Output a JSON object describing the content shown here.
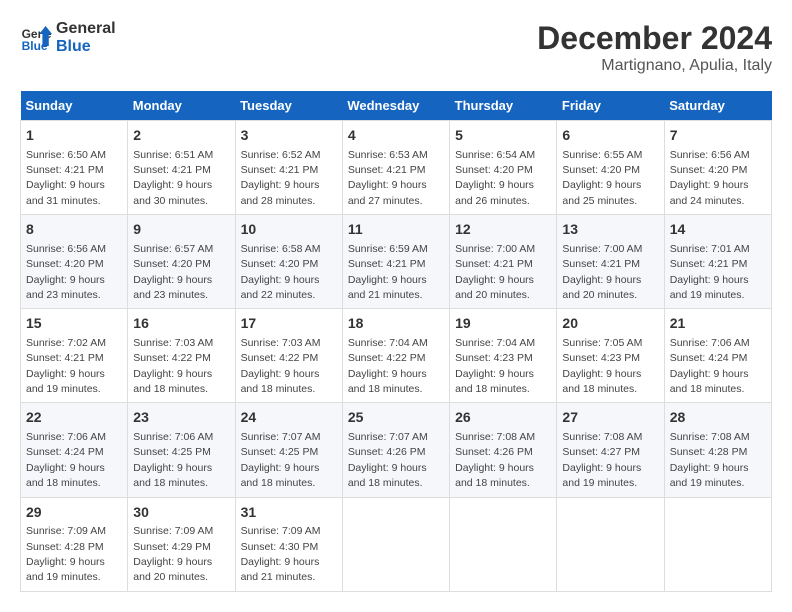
{
  "header": {
    "logo_line1": "General",
    "logo_line2": "Blue",
    "month_year": "December 2024",
    "location": "Martignano, Apulia, Italy"
  },
  "weekdays": [
    "Sunday",
    "Monday",
    "Tuesday",
    "Wednesday",
    "Thursday",
    "Friday",
    "Saturday"
  ],
  "weeks": [
    [
      {
        "day": "1",
        "sunrise": "Sunrise: 6:50 AM",
        "sunset": "Sunset: 4:21 PM",
        "daylight": "Daylight: 9 hours and 31 minutes."
      },
      {
        "day": "2",
        "sunrise": "Sunrise: 6:51 AM",
        "sunset": "Sunset: 4:21 PM",
        "daylight": "Daylight: 9 hours and 30 minutes."
      },
      {
        "day": "3",
        "sunrise": "Sunrise: 6:52 AM",
        "sunset": "Sunset: 4:21 PM",
        "daylight": "Daylight: 9 hours and 28 minutes."
      },
      {
        "day": "4",
        "sunrise": "Sunrise: 6:53 AM",
        "sunset": "Sunset: 4:21 PM",
        "daylight": "Daylight: 9 hours and 27 minutes."
      },
      {
        "day": "5",
        "sunrise": "Sunrise: 6:54 AM",
        "sunset": "Sunset: 4:20 PM",
        "daylight": "Daylight: 9 hours and 26 minutes."
      },
      {
        "day": "6",
        "sunrise": "Sunrise: 6:55 AM",
        "sunset": "Sunset: 4:20 PM",
        "daylight": "Daylight: 9 hours and 25 minutes."
      },
      {
        "day": "7",
        "sunrise": "Sunrise: 6:56 AM",
        "sunset": "Sunset: 4:20 PM",
        "daylight": "Daylight: 9 hours and 24 minutes."
      }
    ],
    [
      {
        "day": "8",
        "sunrise": "Sunrise: 6:56 AM",
        "sunset": "Sunset: 4:20 PM",
        "daylight": "Daylight: 9 hours and 23 minutes."
      },
      {
        "day": "9",
        "sunrise": "Sunrise: 6:57 AM",
        "sunset": "Sunset: 4:20 PM",
        "daylight": "Daylight: 9 hours and 23 minutes."
      },
      {
        "day": "10",
        "sunrise": "Sunrise: 6:58 AM",
        "sunset": "Sunset: 4:20 PM",
        "daylight": "Daylight: 9 hours and 22 minutes."
      },
      {
        "day": "11",
        "sunrise": "Sunrise: 6:59 AM",
        "sunset": "Sunset: 4:21 PM",
        "daylight": "Daylight: 9 hours and 21 minutes."
      },
      {
        "day": "12",
        "sunrise": "Sunrise: 7:00 AM",
        "sunset": "Sunset: 4:21 PM",
        "daylight": "Daylight: 9 hours and 20 minutes."
      },
      {
        "day": "13",
        "sunrise": "Sunrise: 7:00 AM",
        "sunset": "Sunset: 4:21 PM",
        "daylight": "Daylight: 9 hours and 20 minutes."
      },
      {
        "day": "14",
        "sunrise": "Sunrise: 7:01 AM",
        "sunset": "Sunset: 4:21 PM",
        "daylight": "Daylight: 9 hours and 19 minutes."
      }
    ],
    [
      {
        "day": "15",
        "sunrise": "Sunrise: 7:02 AM",
        "sunset": "Sunset: 4:21 PM",
        "daylight": "Daylight: 9 hours and 19 minutes."
      },
      {
        "day": "16",
        "sunrise": "Sunrise: 7:03 AM",
        "sunset": "Sunset: 4:22 PM",
        "daylight": "Daylight: 9 hours and 18 minutes."
      },
      {
        "day": "17",
        "sunrise": "Sunrise: 7:03 AM",
        "sunset": "Sunset: 4:22 PM",
        "daylight": "Daylight: 9 hours and 18 minutes."
      },
      {
        "day": "18",
        "sunrise": "Sunrise: 7:04 AM",
        "sunset": "Sunset: 4:22 PM",
        "daylight": "Daylight: 9 hours and 18 minutes."
      },
      {
        "day": "19",
        "sunrise": "Sunrise: 7:04 AM",
        "sunset": "Sunset: 4:23 PM",
        "daylight": "Daylight: 9 hours and 18 minutes."
      },
      {
        "day": "20",
        "sunrise": "Sunrise: 7:05 AM",
        "sunset": "Sunset: 4:23 PM",
        "daylight": "Daylight: 9 hours and 18 minutes."
      },
      {
        "day": "21",
        "sunrise": "Sunrise: 7:06 AM",
        "sunset": "Sunset: 4:24 PM",
        "daylight": "Daylight: 9 hours and 18 minutes."
      }
    ],
    [
      {
        "day": "22",
        "sunrise": "Sunrise: 7:06 AM",
        "sunset": "Sunset: 4:24 PM",
        "daylight": "Daylight: 9 hours and 18 minutes."
      },
      {
        "day": "23",
        "sunrise": "Sunrise: 7:06 AM",
        "sunset": "Sunset: 4:25 PM",
        "daylight": "Daylight: 9 hours and 18 minutes."
      },
      {
        "day": "24",
        "sunrise": "Sunrise: 7:07 AM",
        "sunset": "Sunset: 4:25 PM",
        "daylight": "Daylight: 9 hours and 18 minutes."
      },
      {
        "day": "25",
        "sunrise": "Sunrise: 7:07 AM",
        "sunset": "Sunset: 4:26 PM",
        "daylight": "Daylight: 9 hours and 18 minutes."
      },
      {
        "day": "26",
        "sunrise": "Sunrise: 7:08 AM",
        "sunset": "Sunset: 4:26 PM",
        "daylight": "Daylight: 9 hours and 18 minutes."
      },
      {
        "day": "27",
        "sunrise": "Sunrise: 7:08 AM",
        "sunset": "Sunset: 4:27 PM",
        "daylight": "Daylight: 9 hours and 19 minutes."
      },
      {
        "day": "28",
        "sunrise": "Sunrise: 7:08 AM",
        "sunset": "Sunset: 4:28 PM",
        "daylight": "Daylight: 9 hours and 19 minutes."
      }
    ],
    [
      {
        "day": "29",
        "sunrise": "Sunrise: 7:09 AM",
        "sunset": "Sunset: 4:28 PM",
        "daylight": "Daylight: 9 hours and 19 minutes."
      },
      {
        "day": "30",
        "sunrise": "Sunrise: 7:09 AM",
        "sunset": "Sunset: 4:29 PM",
        "daylight": "Daylight: 9 hours and 20 minutes."
      },
      {
        "day": "31",
        "sunrise": "Sunrise: 7:09 AM",
        "sunset": "Sunset: 4:30 PM",
        "daylight": "Daylight: 9 hours and 21 minutes."
      },
      null,
      null,
      null,
      null
    ]
  ]
}
